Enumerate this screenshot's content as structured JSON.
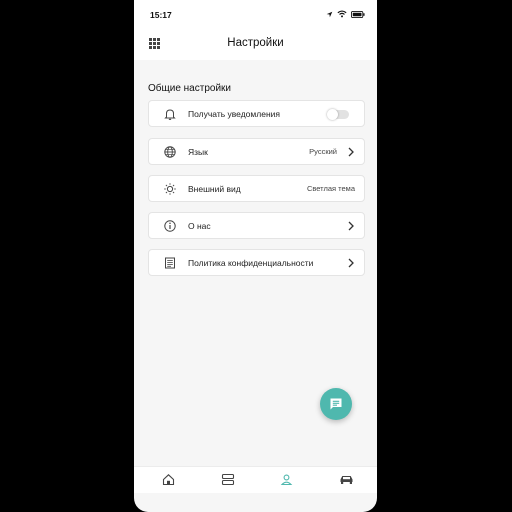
{
  "statusbar": {
    "time": "15:17",
    "icons": [
      "location-arrow-icon",
      "wifi-icon",
      "battery-icon"
    ]
  },
  "header": {
    "title": "Настройки",
    "left_icon": "qr-code-icon"
  },
  "section": {
    "title": "Общие настройки"
  },
  "settings": [
    {
      "icon": "bell-icon",
      "label": "Получать уведомления",
      "control": "toggle",
      "toggle_on": false
    },
    {
      "icon": "globe-icon",
      "label": "Язык",
      "value": "Русский",
      "control": "chevron"
    },
    {
      "icon": "sun-icon",
      "label": "Внешний вид",
      "value": "Светлая тема",
      "control": "none"
    },
    {
      "icon": "info-icon",
      "label": "О нас",
      "control": "chevron"
    },
    {
      "icon": "document-icon",
      "label": "Политика конфиденциальности",
      "control": "chevron"
    }
  ],
  "fab": {
    "icon": "chat-icon"
  },
  "bottom_nav": [
    {
      "icon": "home-icon",
      "active": false
    },
    {
      "icon": "list-icon",
      "active": false
    },
    {
      "icon": "profile-icon",
      "active": true
    },
    {
      "icon": "car-icon",
      "active": false
    }
  ],
  "colors": {
    "accent": "#4fb8ae",
    "background": "#f6f6f6",
    "card": "#ffffff",
    "border": "#e4e4e4"
  }
}
